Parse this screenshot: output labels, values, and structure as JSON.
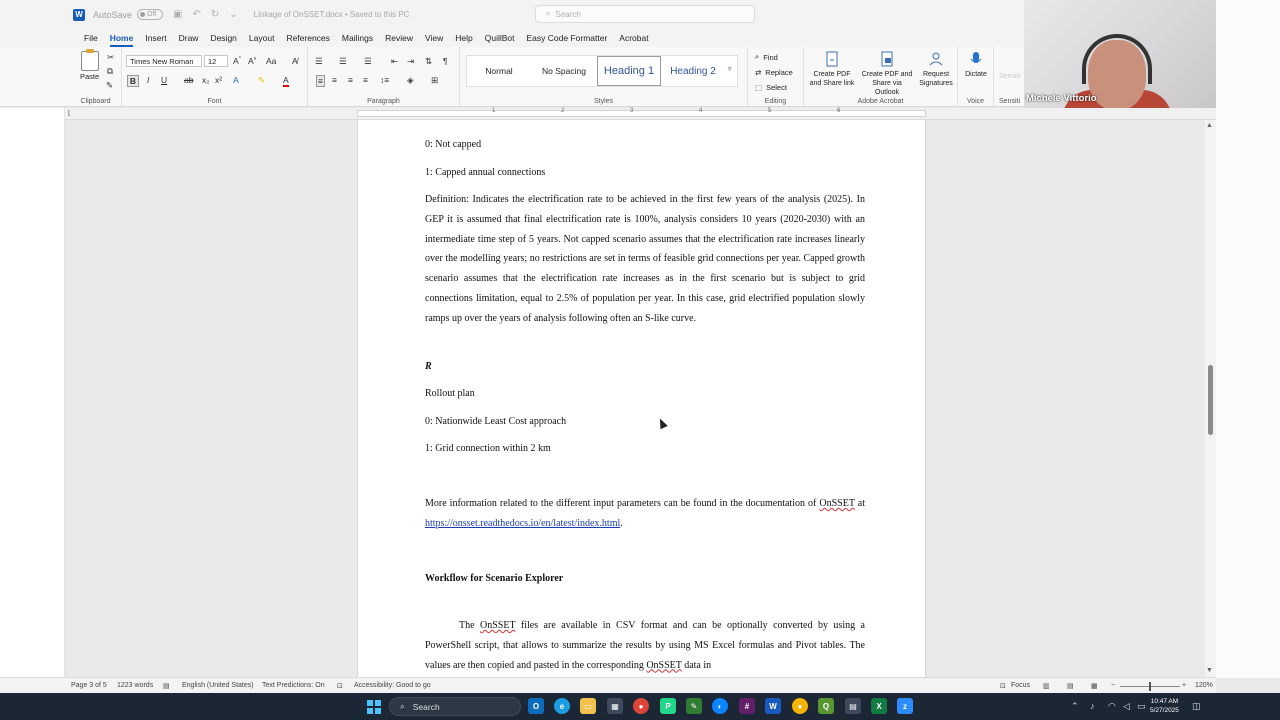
{
  "titlebar": {
    "logo": "W",
    "autosave_label": "AutoSave",
    "autosave_state": "Off",
    "doc_title": "Linkage of OnSSET.docx • Saved to this PC",
    "search_placeholder": "Search"
  },
  "menu": [
    "File",
    "Home",
    "Insert",
    "Draw",
    "Design",
    "Layout",
    "References",
    "Mailings",
    "Review",
    "View",
    "Help",
    "QuillBot",
    "Easy Code Formatter",
    "Acrobat"
  ],
  "ribbon": {
    "clipboard": {
      "paste": "Paste",
      "label": "Clipboard"
    },
    "font": {
      "name": "Times New Roman",
      "size": "12",
      "label": "Font",
      "bold": "B",
      "italic": "I",
      "underline": "U"
    },
    "paragraph": {
      "label": "Paragraph"
    },
    "styles": {
      "items": [
        "Normal",
        "No Spacing",
        "Heading 1",
        "Heading 2"
      ],
      "label": "Styles"
    },
    "editing": {
      "find": "Find",
      "replace": "Replace",
      "select": "Select",
      "label": "Editing"
    },
    "acrobat": {
      "create_pdf": "Create PDF and Share link",
      "create_pdf_outlook": "Create PDF and Share via Outlook",
      "request_signatures": "Request Signatures",
      "label": "Adobe Acrobat"
    },
    "voice": {
      "dictate": "Dictate",
      "label": "Voice"
    },
    "sensitivity": {
      "label": "Sensiti",
      "top": "Sensiti"
    }
  },
  "webcam": {
    "name": "Michele Vittorio"
  },
  "ruler": [
    "1",
    "2",
    "3",
    "4",
    "5",
    "6"
  ],
  "document": {
    "line_not_capped": "0: Not capped",
    "line_capped": "1: Capped annual connections",
    "definition_para": "Definition: Indicates the electrification rate to be achieved in the first few years of the analysis (2025). In GEP it is assumed that final electrification rate is 100%, analysis considers 10 years (2020-2030) with an intermediate time step of 5 years. Not capped scenario assumes that the electrification rate increases linearly over the modelling years; no restrictions are set in terms of feasible grid connections per year. Capped growth scenario assumes that the electrification rate increases as in the first scenario but is subject to grid connections limitation, equal to 2.5% of population per year. In this case, grid electrified population slowly ramps up over the years of analysis following often an S-like curve.",
    "r_label": "R",
    "rollout": "Rollout plan",
    "rollout_0": "0: Nationwide Least Cost approach",
    "rollout_1": "1: Grid connection within 2 km",
    "more_info_1": "More information related to the different input parameters can be found in the documentation",
    "more_info_of": "of ",
    "onsset": "OnSSET",
    "more_info_at": " at ",
    "link": "https://onsset.readthedocs.io/en/latest/index.html",
    "period": ".",
    "workflow_heading": "Workflow for Scenario Explorer",
    "workflow_p1": "The ",
    "workflow_p2": " files are available in CSV format and can be optionally converted by using a PowerShell script, that allows to summarize the results by using MS Excel formulas and Pivot tables. The values are then copied and pasted in the corresponding ",
    "workflow_p3": " data in"
  },
  "statusbar": {
    "page": "Page 3 of 5",
    "words": "1223 words",
    "language": "English (United States)",
    "predictions": "Text Predictions: On",
    "accessibility": "Accessibility: Good to go",
    "focus": "Focus",
    "zoom": "120%"
  },
  "taskbar": {
    "search": "Search",
    "time": "10:47 AM",
    "date": "5/27/2025"
  }
}
